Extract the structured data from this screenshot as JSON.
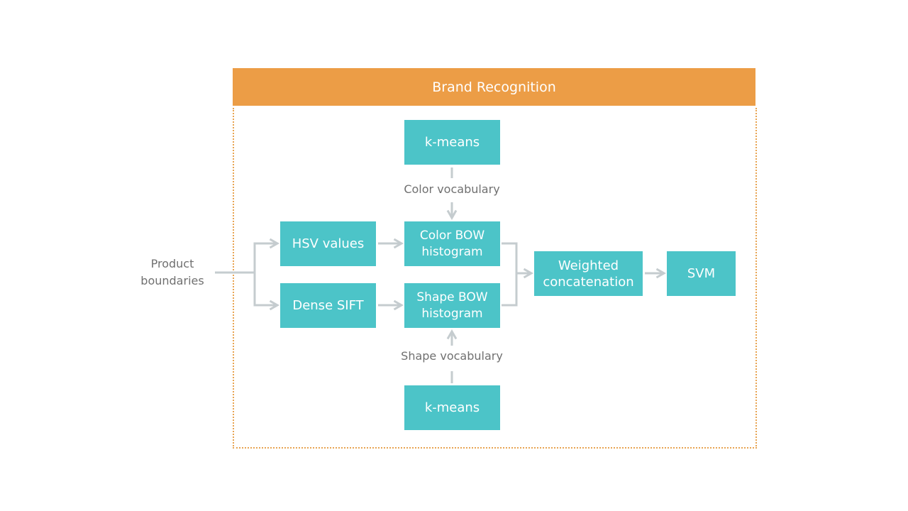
{
  "title": "Brand Recognition",
  "input_label": "Product\nboundaries",
  "nodes": {
    "kmeans_top": "k-means",
    "hsv": "HSV values",
    "dense_sift": "Dense SIFT",
    "color_bow": "Color BOW histogram",
    "shape_bow": "Shape BOW histogram",
    "weighted": "Weighted concatenation",
    "svm": "SVM",
    "kmeans_bottom": "k-means"
  },
  "edge_labels": {
    "color_vocab": "Color vocabulary",
    "shape_vocab": "Shape vocabulary"
  },
  "colors": {
    "header": "#ec9d46",
    "box": "#4cc4c8",
    "connector": "#c5cccf",
    "frame": "#e8a452"
  }
}
